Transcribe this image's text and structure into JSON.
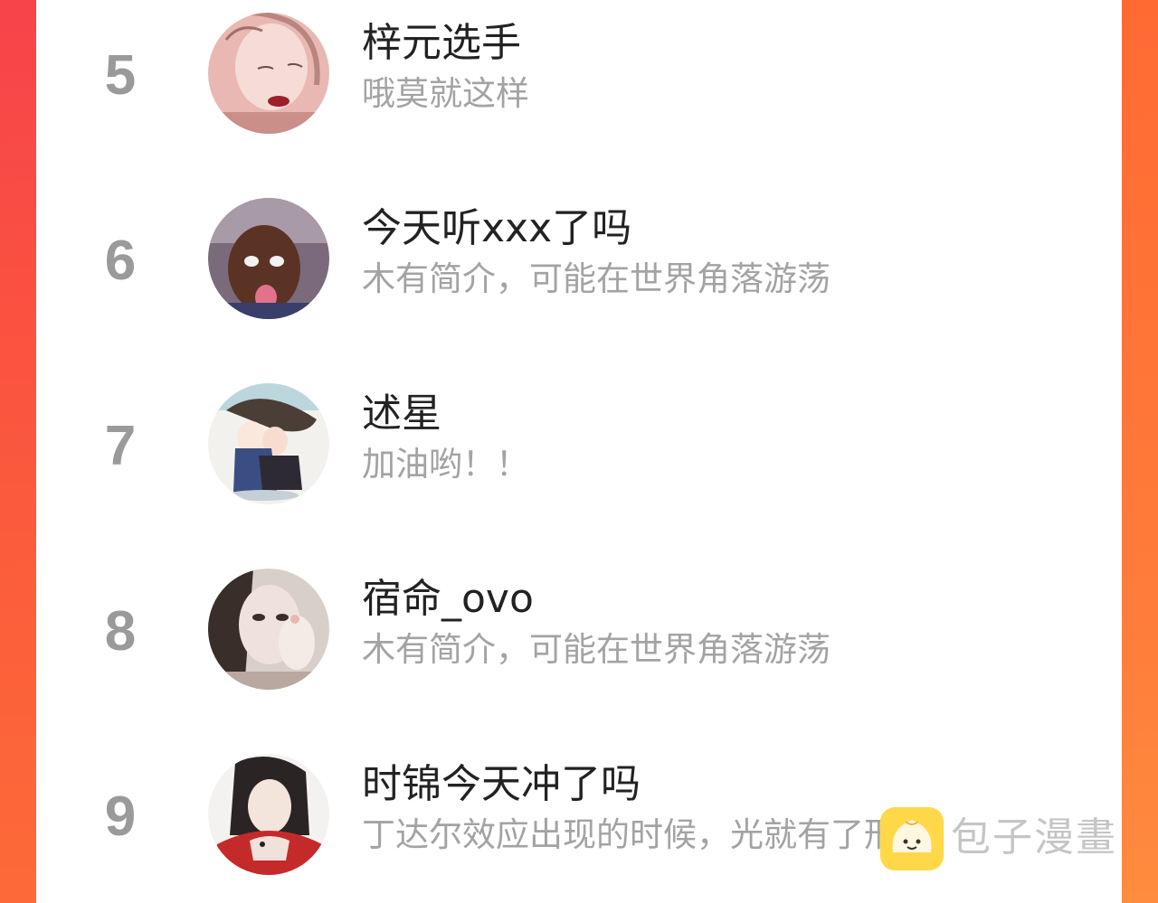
{
  "rows": [
    {
      "rank": "5",
      "name": "梓元选手",
      "bio": "哦莫就这样",
      "avatar": "avatar-pale-portrait"
    },
    {
      "rank": "6",
      "name": "今天听xxx了吗",
      "bio": "木有简介，可能在世界角落游荡",
      "avatar": "avatar-meme-face"
    },
    {
      "rank": "7",
      "name": "述星",
      "bio": "加油哟！！",
      "avatar": "avatar-chibi-couple"
    },
    {
      "rank": "8",
      "name": "宿命_ovo",
      "bio": "木有简介，可能在世界角落游荡",
      "avatar": "avatar-girl-selfie"
    },
    {
      "rank": "9",
      "name": "时锦今天冲了吗",
      "bio": "丁达尔效应出现的时候，光就有了形状。",
      "avatar": "avatar-red-robe"
    }
  ],
  "watermark": {
    "text": "包子漫畫",
    "icon": "bun-logo-icon"
  },
  "colors": {
    "left_band": "#f94a4a",
    "right_band": "#ff7d3a",
    "rank": "#9a9a9a",
    "name": "#222222",
    "bio": "#a3a3a3"
  }
}
